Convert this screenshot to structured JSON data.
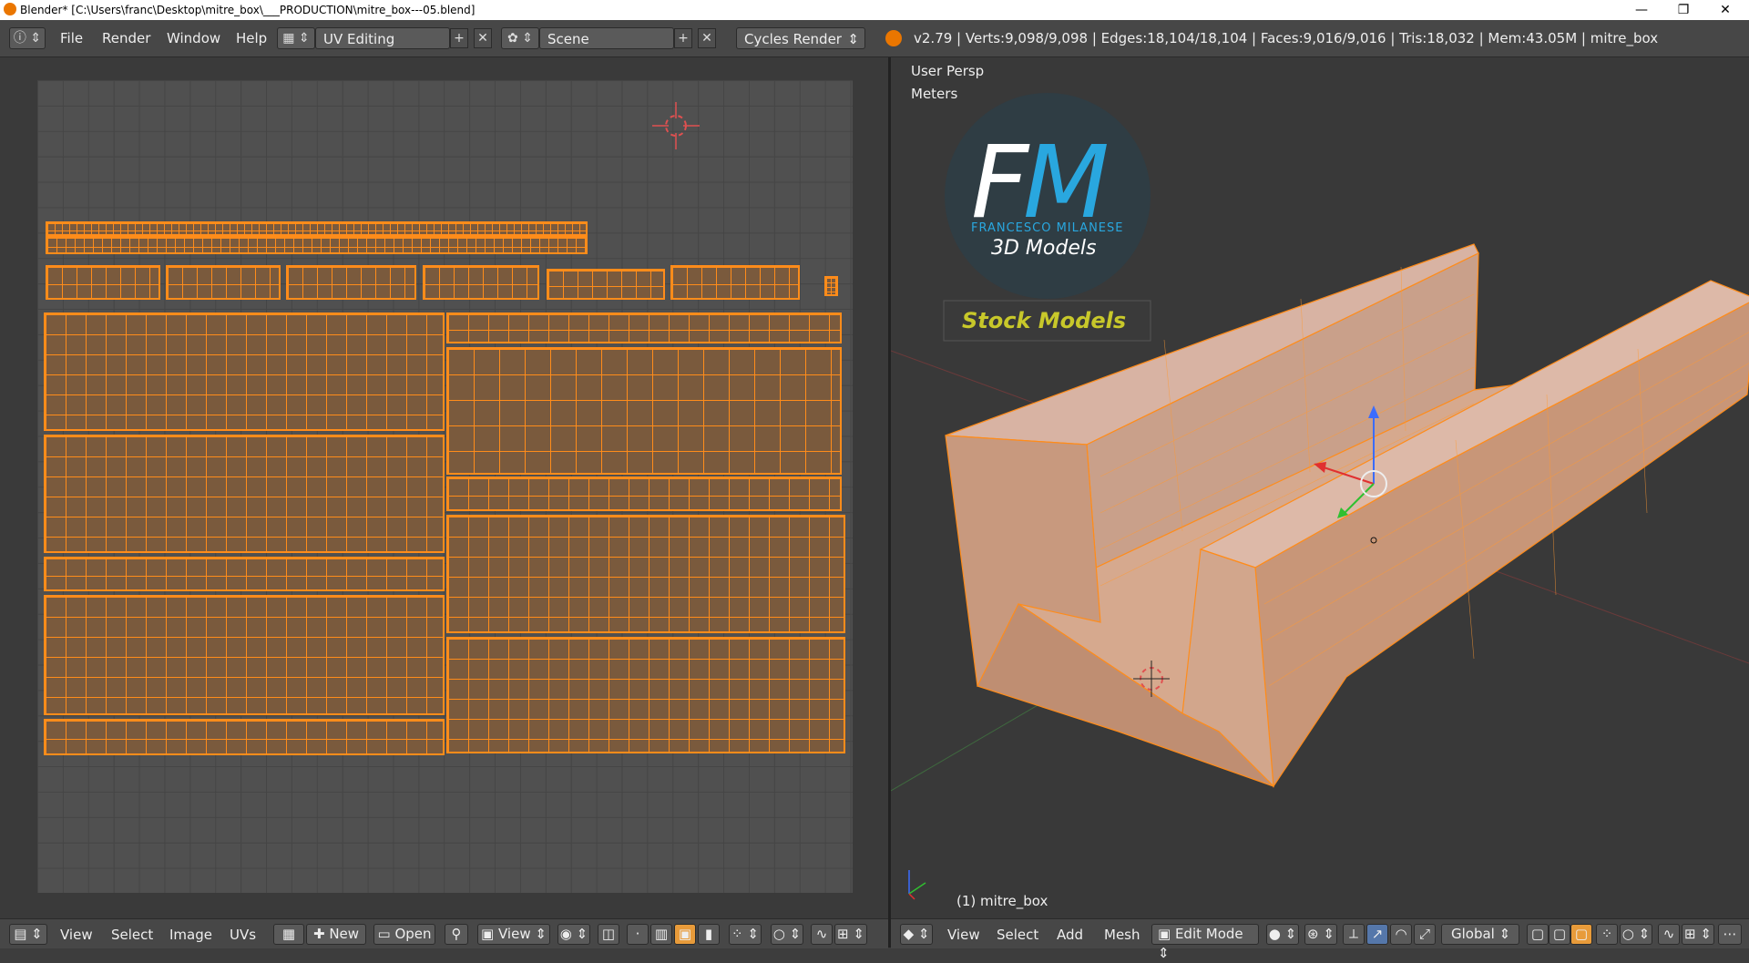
{
  "window": {
    "title": "Blender* [C:\\Users\\franc\\Desktop\\mitre_box\\___PRODUCTION\\mitre_box---05.blend]",
    "minimize": "—",
    "maximize": "❐",
    "close": "✕"
  },
  "topbar": {
    "menus": [
      "File",
      "Render",
      "Window",
      "Help"
    ],
    "screen_layout": "UV Editing",
    "scene": "Scene",
    "render_engine": "Cycles Render",
    "stats": "v2.79 | Verts:9,098/9,098 | Edges:18,104/18,104 | Faces:9,016/9,016 | Tris:18,032 | Mem:43.05M | mitre_box"
  },
  "viewport": {
    "view_name": "User Persp",
    "units": "Meters",
    "object_label": "(1) mitre_box",
    "logo": {
      "monogram": "FM",
      "brand": "FRANCESCO MILANESE",
      "tagline": "3D Models",
      "badge": "Stock Models"
    }
  },
  "uv_header": {
    "menus": [
      "View",
      "Select",
      "Image",
      "UVs"
    ],
    "new_label": "New",
    "open_label": "Open",
    "view_label": "View"
  },
  "view3d_header": {
    "menus": [
      "View",
      "Select",
      "Add",
      "Mesh"
    ],
    "mode": "Edit Mode",
    "orientation": "Global"
  },
  "colors": {
    "accent": "#ff8c1a",
    "mesh_face": "#d9a07e",
    "background": "#393939"
  }
}
